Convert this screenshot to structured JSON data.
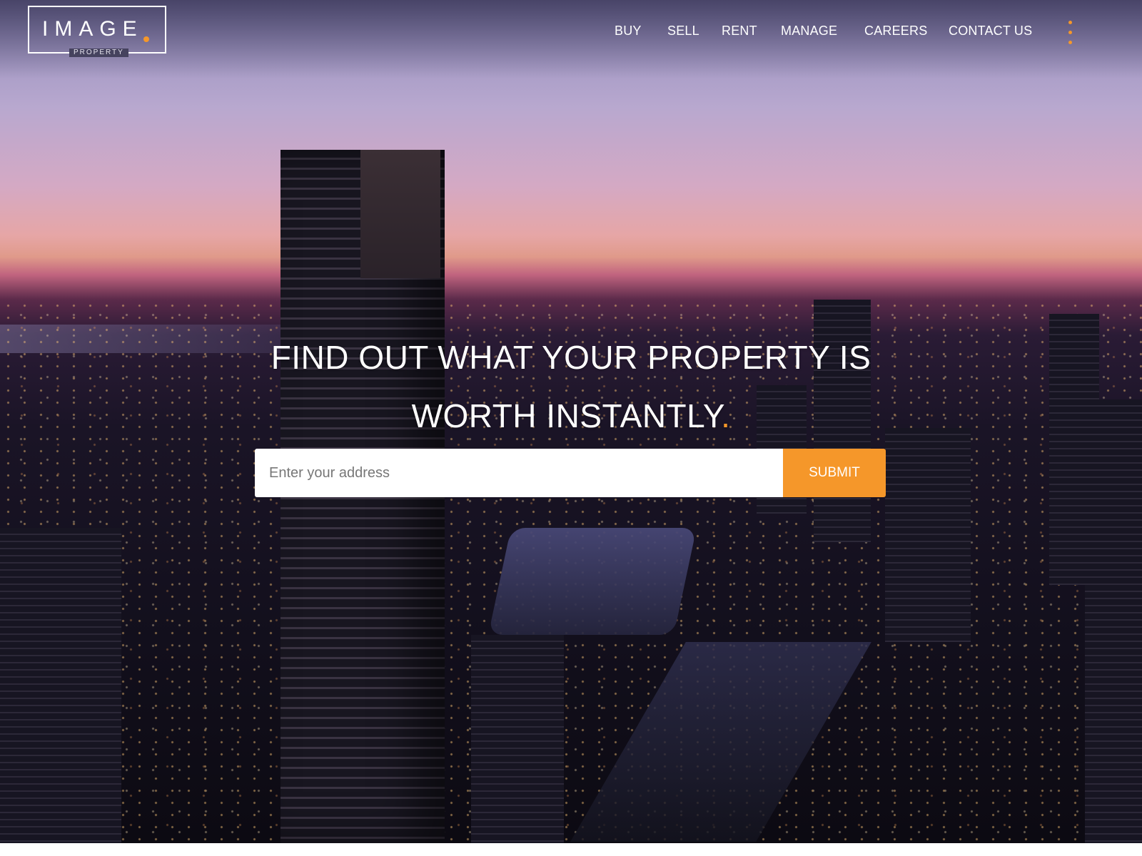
{
  "brand": {
    "logo_text": "IMAGE",
    "logo_subtext": "PROPERTY",
    "accent_color": "#f5972a"
  },
  "nav": {
    "items": [
      {
        "label": "BUY"
      },
      {
        "label": "SELL"
      },
      {
        "label": "RENT"
      },
      {
        "label": "MANAGE"
      },
      {
        "label": "CAREERS"
      },
      {
        "label": "CONTACT US"
      }
    ],
    "menu_icon": "kebab-menu-icon"
  },
  "hero": {
    "headline_line1": "FIND OUT WHAT YOUR PROPERTY IS",
    "headline_line2": "WORTH INSTANTLY",
    "headline_dot": "."
  },
  "search": {
    "placeholder": "Enter your address",
    "value": "",
    "submit_label": "SUBMIT"
  }
}
